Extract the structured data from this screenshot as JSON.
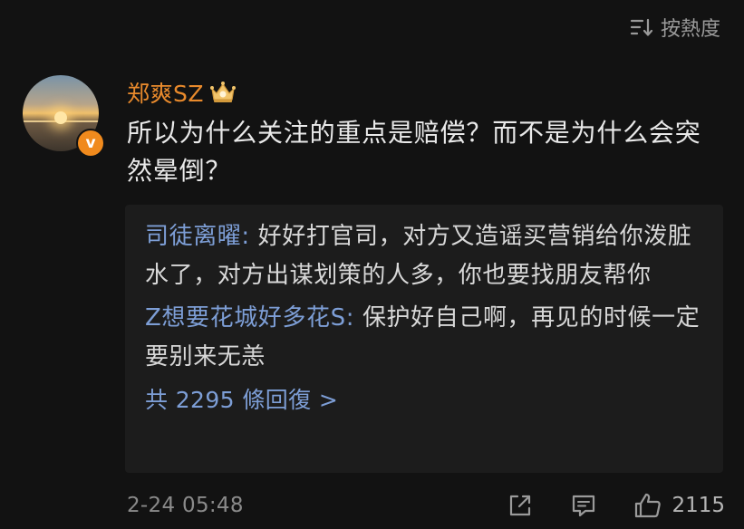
{
  "sort": {
    "label": "按熱度",
    "icon": "sort-icon"
  },
  "comment": {
    "username": "郑爽SZ",
    "username_color": "#e98a2c",
    "badge_icon": "crown-badge-icon",
    "verified_icon": "verified-v-icon",
    "verified_glyph": "v",
    "text": "所以为什么关注的重点是赔偿？而不是为什么会突然晕倒？",
    "timestamp": "2-24 05:48"
  },
  "replies": {
    "items": [
      {
        "author": "司徒离曜:",
        "text": " 好好打官司，对方又造谣买营销给你泼脏水了，对方出谋划策的人多，你也要找朋友帮你"
      },
      {
        "author": "Z想要花城好多花S:",
        "text": " 保护好自己啊，再见的时候一定要别来无恙"
      }
    ],
    "more_label": "共 2295 條回復 >",
    "link_color": "#7d9ed6"
  },
  "actions": {
    "share_icon": "share-icon",
    "reply_icon": "comment-icon",
    "like_icon": "thumbs-up-icon",
    "like_count": "2115"
  }
}
